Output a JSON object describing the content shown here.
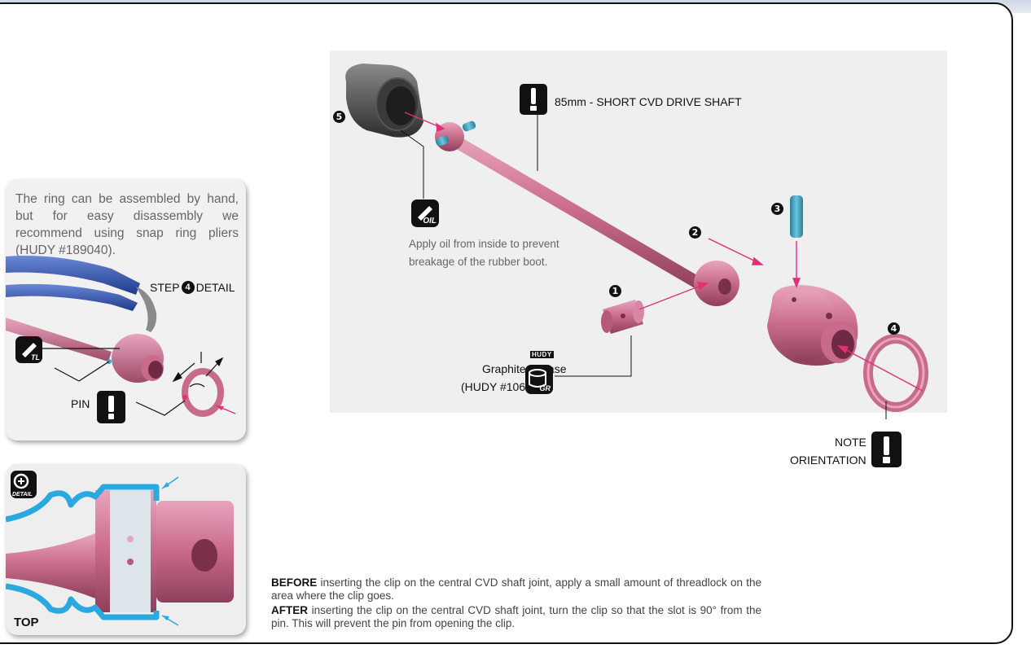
{
  "detail_note": {
    "text": "The ring can be assembled by hand, but for easy disassembly we recommend using snap ring pliers (HUDY #189040).",
    "step_label": "STEP",
    "step_number": "4",
    "step_detail": "DETAIL",
    "pin_label": "PIN",
    "tl_icon_text": "TL"
  },
  "detail_card": {
    "detail_icon_text": "DETAIL",
    "top_label": "TOP"
  },
  "main": {
    "shaft_title": "85mm - SHORT CVD DRIVE SHAFT",
    "oil_icon_text": "OIL",
    "oil_note_line1": "Apply oil from inside to prevent",
    "oil_note_line2": "breakage of the rubber boot.",
    "grease_line1": "Graphite Grease",
    "grease_line2": "(HUDY #106210)",
    "hudy_label": "HUDY",
    "gr_icon_text": "GR",
    "note_line1": "NOTE",
    "note_line2": "ORIENTATION",
    "step_numbers": [
      "1",
      "2",
      "3",
      "4",
      "5"
    ]
  },
  "instructions": {
    "before_bold": "BEFORE",
    "before_text": " inserting the clip on the central CVD shaft joint, apply a small amount of threadlock on the area where the clip goes.",
    "after_bold": "AFTER",
    "after_text": " inserting the clip on the central CVD shaft joint, turn the clip so that the slot is 90° from the pin. This will prevent the pin from opening the clip."
  },
  "colors": {
    "part_pink": "#c86a8a",
    "pin_blue": "#3fa9c8",
    "arrow_magenta": "#e0307a",
    "boot_gray": "#4a4a4a"
  }
}
